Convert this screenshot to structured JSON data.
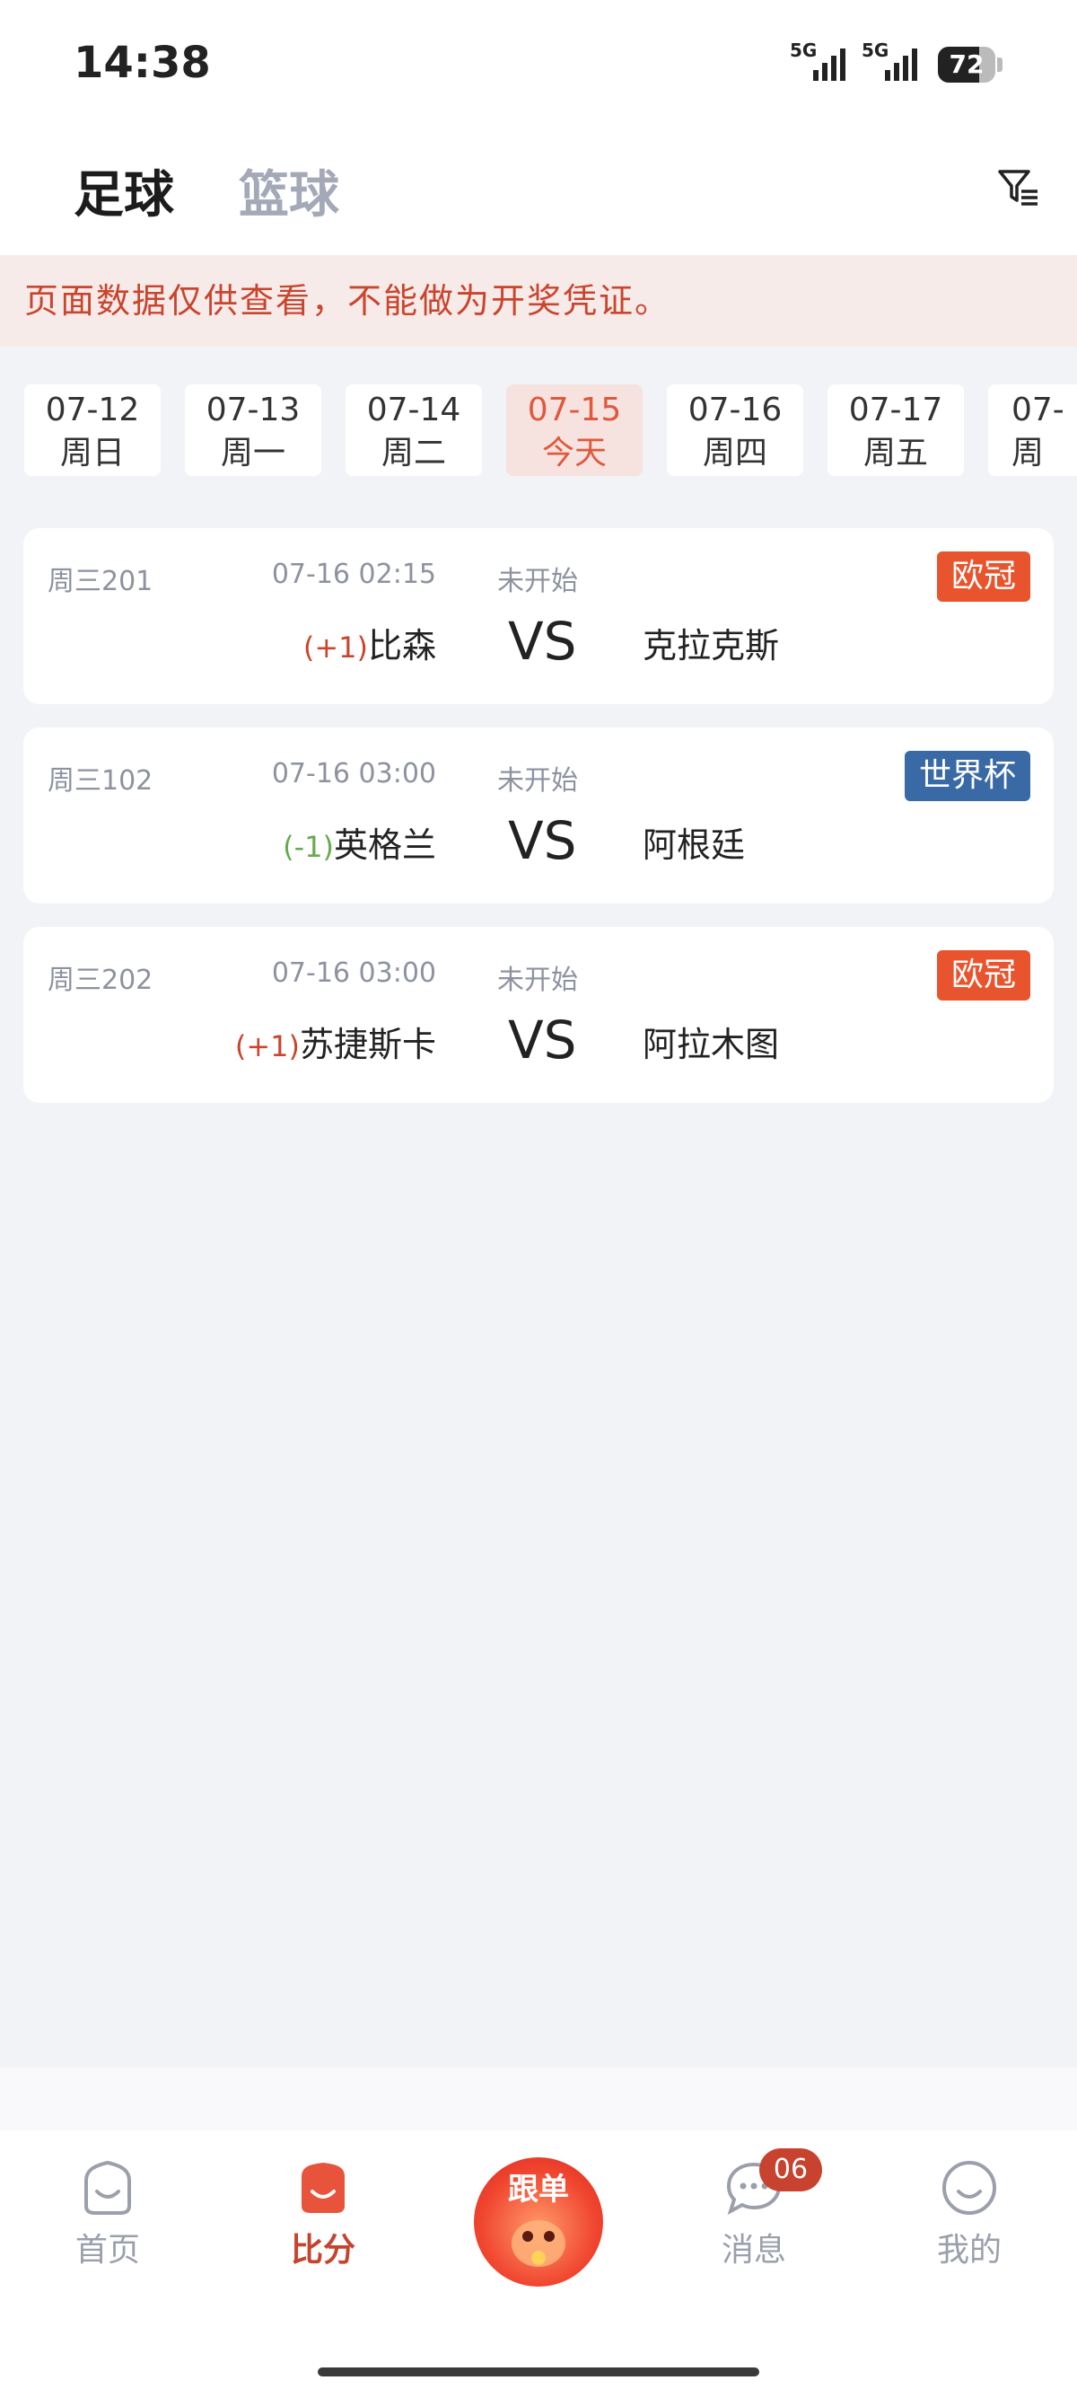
{
  "status_bar": {
    "time": "14:38",
    "signal1": "5G",
    "signal2": "5G",
    "battery": "72",
    "battery_level": 0.72
  },
  "header": {
    "tab_active": "足球",
    "tab_inactive": "篮球",
    "filter_icon": "filter-icon"
  },
  "notice": "页面数据仅供查看，不能做为开奖凭证。",
  "dates": [
    {
      "date": "07-12",
      "weekday": "周日"
    },
    {
      "date": "07-13",
      "weekday": "周一"
    },
    {
      "date": "07-14",
      "weekday": "周二"
    },
    {
      "date": "07-15",
      "weekday": "今天"
    },
    {
      "date": "07-16",
      "weekday": "周四"
    },
    {
      "date": "07-17",
      "weekday": "周五"
    },
    {
      "date": "07-",
      "weekday": "周"
    }
  ],
  "active_date_index": 3,
  "matches": [
    {
      "code": "周三201",
      "time": "07-16 02:15",
      "status": "未开始",
      "league": "欧冠",
      "league_color": "#e8542d",
      "handicap": "(+1)",
      "handicap_color": "#c9452e",
      "home": "比森",
      "vs": "VS",
      "away": "克拉克斯"
    },
    {
      "code": "周三102",
      "time": "07-16 03:00",
      "status": "未开始",
      "league": "世界杯",
      "league_color": "#3a6aa5",
      "handicap": "(-1)",
      "handicap_color": "#6aa84f",
      "home": "英格兰",
      "vs": "VS",
      "away": "阿根廷"
    },
    {
      "code": "周三202",
      "time": "07-16 03:00",
      "status": "未开始",
      "league": "欧冠",
      "league_color": "#e8542d",
      "handicap": "(+1)",
      "handicap_color": "#c9452e",
      "home": "苏捷斯卡",
      "vs": "VS",
      "away": "阿拉木图"
    }
  ],
  "nav": {
    "home": "首页",
    "score": "比分",
    "follow": "跟单",
    "messages": "消息",
    "messages_badge": "06",
    "mine": "我的"
  },
  "colors": {
    "accent": "#c6432e",
    "inactive": "#9a9fab"
  }
}
